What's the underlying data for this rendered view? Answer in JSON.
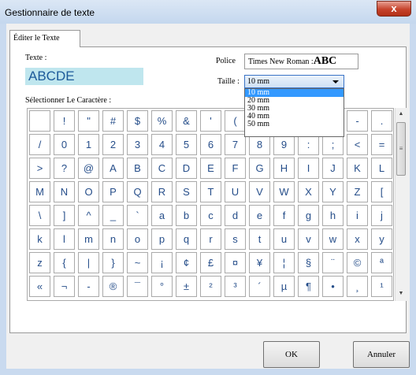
{
  "window": {
    "title": "Gestionnaire de texte",
    "close_glyph": "x"
  },
  "tabs": [
    {
      "label": "Éditer le Texte"
    }
  ],
  "text_label": "Texte :",
  "text_value": "ABCDE",
  "font": {
    "label": "Police",
    "value": "Times New Roman :",
    "sample": "ABC"
  },
  "size": {
    "label": "Taille :",
    "selected": "10 mm",
    "options": [
      "10 mm",
      "20 mm",
      "30 mm",
      "40 mm",
      "50 mm"
    ]
  },
  "select_char_label": "Sélectionner Le Caractère :",
  "characters": [
    " ",
    "!",
    "\"",
    "#",
    "$",
    "%",
    "&",
    "'",
    "(",
    ")",
    "*",
    "+",
    ",",
    "-",
    ".",
    "/",
    "0",
    "1",
    "2",
    "3",
    "4",
    "5",
    "6",
    "7",
    "8",
    "9",
    ":",
    ";",
    "<",
    "=",
    ">",
    "?",
    "@",
    "A",
    "B",
    "C",
    "D",
    "E",
    "F",
    "G",
    "H",
    "I",
    "J",
    "K",
    "L",
    "M",
    "N",
    "O",
    "P",
    "Q",
    "R",
    "S",
    "T",
    "U",
    "V",
    "W",
    "X",
    "Y",
    "Z",
    "[",
    "\\",
    "]",
    "^",
    "_",
    "`",
    "a",
    "b",
    "c",
    "d",
    "e",
    "f",
    "g",
    "h",
    "i",
    "j",
    "k",
    "l",
    "m",
    "n",
    "o",
    "p",
    "q",
    "r",
    "s",
    "t",
    "u",
    "v",
    "w",
    "x",
    "y",
    "z",
    "{",
    "|",
    "}",
    "~",
    "¡",
    "¢",
    "£",
    "¤",
    "¥",
    "¦",
    "§",
    "¨",
    "©",
    "ª",
    "«",
    "¬",
    "-",
    "®",
    "¯",
    "°",
    "±",
    "²",
    "³",
    "´",
    "µ",
    "¶",
    "•",
    "¸",
    "¹"
  ],
  "scrollbar": {
    "up": "▲",
    "down": "▼",
    "grip": "≡"
  },
  "buttons": {
    "ok": "OK",
    "cancel": "Annuler"
  }
}
